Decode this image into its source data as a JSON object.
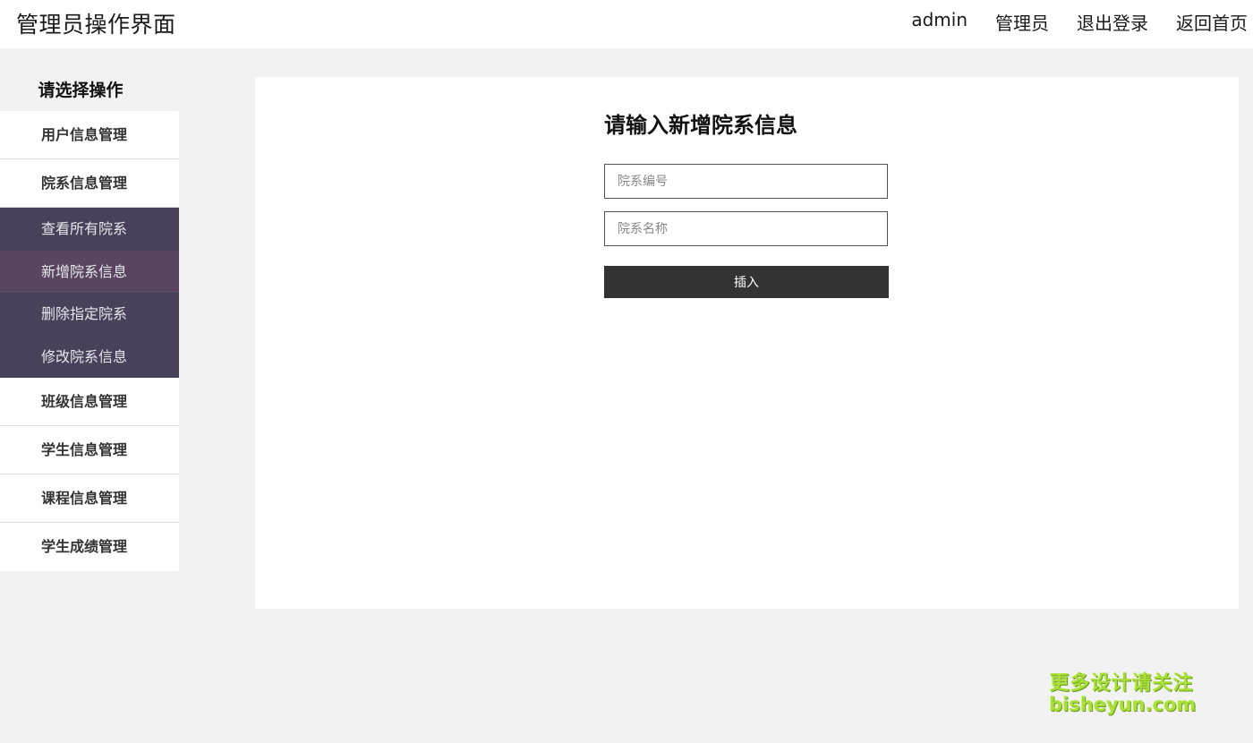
{
  "header": {
    "title": "管理员操作界面",
    "nav": [
      "admin",
      "管理员",
      "退出登录",
      "返回首页"
    ]
  },
  "sidebar": {
    "title": "请选择操作",
    "groups_top": [
      "用户信息管理",
      "院系信息管理"
    ],
    "submenu": [
      "查看所有院系",
      "新增院系信息",
      "删除指定院系",
      "修改院系信息"
    ],
    "groups_bottom": [
      "班级信息管理",
      "学生信息管理",
      "课程信息管理",
      "学生成绩管理"
    ]
  },
  "form": {
    "title": "请输入新增院系信息",
    "dept_id_placeholder": "院系编号",
    "dept_name_placeholder": "院系名称",
    "submit_label": "插入"
  },
  "watermark": {
    "line1": "更多设计请关注",
    "line2": "bisheyun.com"
  },
  "colors": {
    "submenu_bg": "#47425a",
    "submenu_active_bg": "#5a4560",
    "button_bg": "#333333",
    "watermark": "#a8e038"
  }
}
